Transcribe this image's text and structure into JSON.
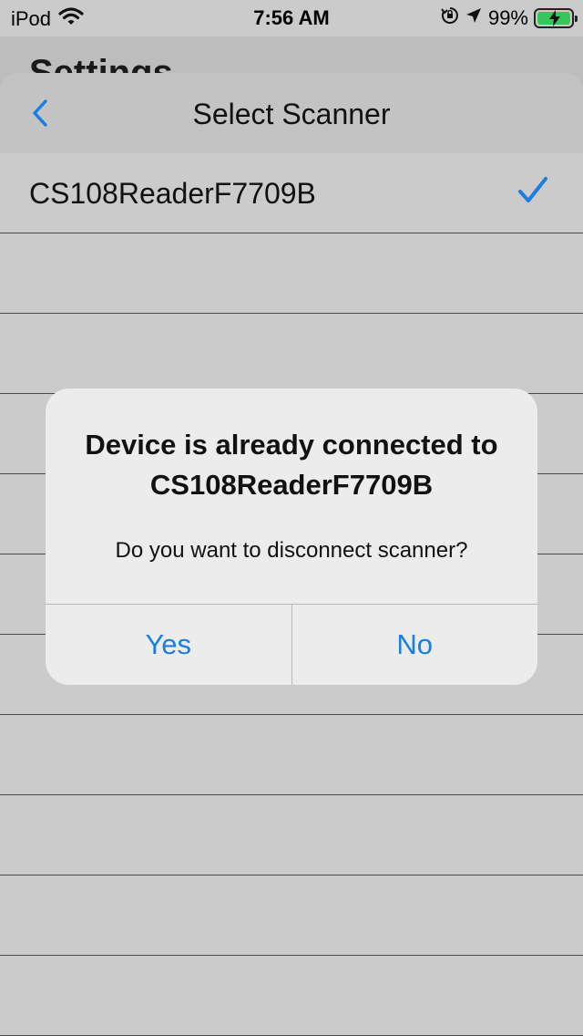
{
  "status_bar": {
    "carrier": "iPod",
    "time": "7:56 AM",
    "battery_percent": "99%",
    "battery_level": 0.99,
    "icons": [
      "wifi-icon",
      "orientation-lock-icon",
      "location-arrow-icon",
      "battery-charging-icon"
    ]
  },
  "background": {
    "title": "Settings"
  },
  "nav": {
    "title": "Select Scanner",
    "back_icon": "chevron-left-icon"
  },
  "scanners": [
    {
      "name": "CS108ReaderF7709B",
      "selected": true
    }
  ],
  "alert": {
    "title": "Device is already connected to CS108ReaderF7709B",
    "message": "Do you want to disconnect scanner?",
    "buttons": {
      "yes": "Yes",
      "no": "No"
    }
  },
  "colors": {
    "accent": "#1a7fe0",
    "battery": "#34c759",
    "dimmed_background": "#cbcbcb"
  }
}
